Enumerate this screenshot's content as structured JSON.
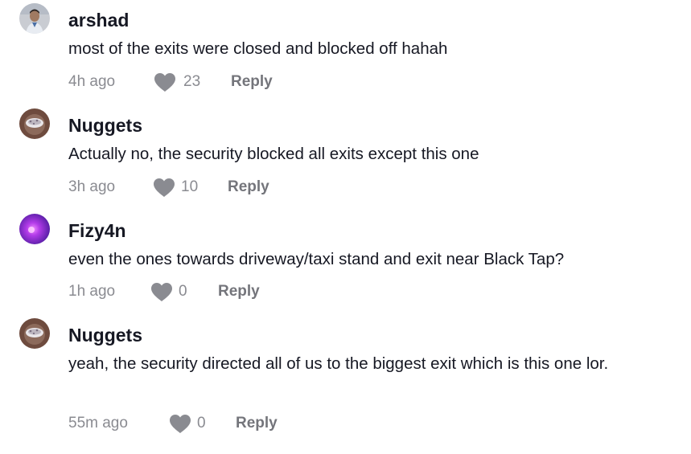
{
  "comments": [
    {
      "user": "arshad",
      "text": "most of the exits were closed and blocked off hahah",
      "time": "4h ago",
      "likes": "23",
      "reply_label": "Reply"
    },
    {
      "user": "Nuggets",
      "text": "Actually no, the security blocked all exits except this one",
      "time": "3h ago",
      "likes": "10",
      "reply_label": "Reply"
    },
    {
      "user": "Fizy4n",
      "text": "even the ones towards driveway/taxi stand and exit near Black Tap?",
      "time": "1h ago",
      "likes": "0",
      "reply_label": "Reply"
    },
    {
      "user": "Nuggets",
      "text": "yeah, the security directed all of us to the biggest exit which is this one lor.",
      "time": "55m ago",
      "likes": "0",
      "reply_label": "Reply"
    }
  ],
  "colors": {
    "text": "#161823",
    "meta": "#8a8b91",
    "heart": "#8a8b91",
    "reply": "#74757b"
  }
}
